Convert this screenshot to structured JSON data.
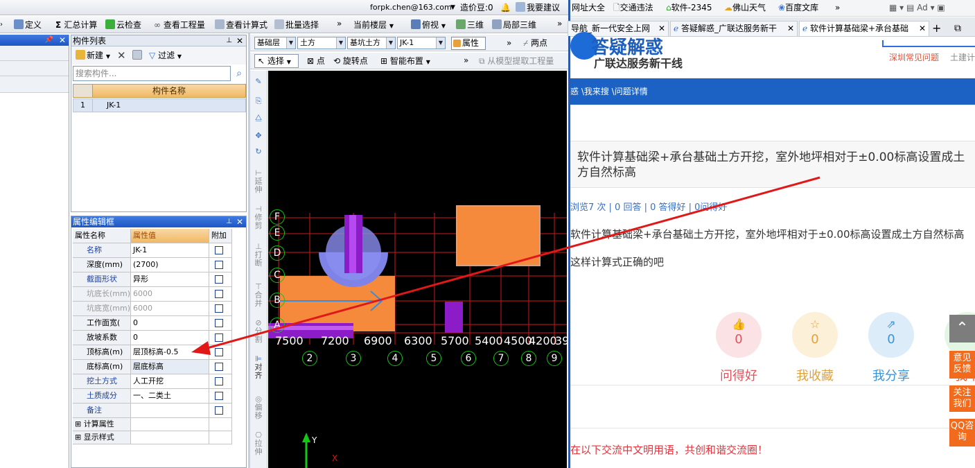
{
  "top_bar": {
    "email": "forpk.chen@163.com",
    "beans": "造价豆:0",
    "suggest": "我要建议"
  },
  "toolbar1": {
    "define": "定义",
    "sum_calc": "汇总计算",
    "cloud_check": "云检查",
    "view_qty": "查看工程量",
    "view_formula": "查看计算式",
    "batch_select": "批量选择",
    "current_floor": "当前楼层",
    "top_view": "俯视",
    "three_d": "三维",
    "local_3d": "局部三维"
  },
  "component_list": {
    "title": "构件列表",
    "new": "新建",
    "filter": "过滤",
    "search_placeholder": "搜索构件...",
    "col_name": "构件名称",
    "rows": [
      {
        "num": "1",
        "name": "JK-1"
      }
    ]
  },
  "prop_editor": {
    "title": "属性编辑框",
    "headers": [
      "属性名称",
      "属性值",
      "附加"
    ],
    "rows": [
      {
        "name": "名称",
        "value": "JK-1",
        "blue": true,
        "gray": false
      },
      {
        "name": "深度(mm)",
        "value": "(2700)",
        "blue": false,
        "gray": false
      },
      {
        "name": "截面形状",
        "value": "异形",
        "blue": true,
        "gray": false
      },
      {
        "name": "坑底长(mm)",
        "value": "6000",
        "blue": false,
        "gray": true
      },
      {
        "name": "坑底宽(mm)",
        "value": "6000",
        "blue": false,
        "gray": true
      },
      {
        "name": "工作面宽(",
        "value": "0",
        "blue": false,
        "gray": false
      },
      {
        "name": "放坡系数",
        "value": "0",
        "blue": false,
        "gray": false
      },
      {
        "name": "顶标高(m)",
        "value": "层顶标高-0.5",
        "blue": false,
        "gray": false
      },
      {
        "name": "底标高(m)",
        "value": "层底标高",
        "blue": false,
        "gray": false
      },
      {
        "name": "挖土方式",
        "value": "人工开挖",
        "blue": true,
        "gray": false
      },
      {
        "name": "土质成分",
        "value": "一、二类土",
        "blue": true,
        "gray": false
      },
      {
        "name": "备注",
        "value": "",
        "blue": true,
        "gray": false
      }
    ],
    "groups": [
      "计算属性",
      "显示样式"
    ]
  },
  "toolbar2": {
    "layer": "基础层",
    "type": "土方",
    "subtype": "基坑土方",
    "component": "JK-1",
    "property": "属性",
    "two_points": "两点"
  },
  "toolbar3": {
    "select": "选择",
    "point": "点",
    "rotate_point": "旋转点",
    "smart_place": "智能布置",
    "extract": "从模型提取工程量"
  },
  "vertical_tools": [
    "延伸",
    "修剪",
    "打断",
    "合并",
    "分割",
    "对齐",
    "偏移",
    "拉伸"
  ],
  "canvas": {
    "row_axes": [
      "F",
      "E",
      "D",
      "C",
      "B",
      "A"
    ],
    "dims": [
      "7500",
      "7200",
      "6900",
      "6300",
      "5700",
      "5400",
      "4500",
      "4200",
      "39"
    ],
    "col_axes": [
      "2",
      "3",
      "4",
      "5",
      "6",
      "7",
      "8",
      "9"
    ],
    "y_label": "Y",
    "x_label": "X"
  },
  "browser": {
    "bookmarks": [
      "网址大全",
      "交通违法",
      "软件-2345",
      "佛山天气",
      "百度文库"
    ],
    "tabs": [
      "导航_新一代安全上网",
      "答疑解惑_广联达服务新干",
      "软件计算基础梁+承台基础"
    ],
    "site_title": "答疑解惑",
    "site_sub": "广联达服务新干线",
    "links": [
      "深圳常见问题",
      "土建计"
    ],
    "breadcrumb": "惑 \\我来搜 \\问题详情",
    "question_title": "软件计算基础梁+承台基础土方开挖，室外地坪相对于±0.00标高设置成土方自然标高",
    "stats": "浏览7 次 | 0 回答 | 0 答得好 | 0问得好",
    "body": "软件计算基础梁+承台基础土方开挖，室外地坪相对于±0.00标高设置成土方自然标高",
    "body2": "这样计算式正确的吧",
    "actions": [
      {
        "count": "0",
        "label": "问得好",
        "color": "#e0535c",
        "bg": "#fbe3e5"
      },
      {
        "count": "0",
        "label": "我收藏",
        "color": "#e0a23c",
        "bg": "#fcf0d9"
      },
      {
        "count": "0",
        "label": "我分享",
        "color": "#3b93d6",
        "bg": "#dcedf9"
      },
      {
        "count": "",
        "label": "我举",
        "color": "#e05a2a",
        "bg": "#e3f5e3"
      }
    ],
    "feedback": [
      "意见反馈",
      "关注我们",
      "QQ咨询"
    ],
    "footer": "在以下交流中文明用语，共创和谐交流圈！"
  }
}
